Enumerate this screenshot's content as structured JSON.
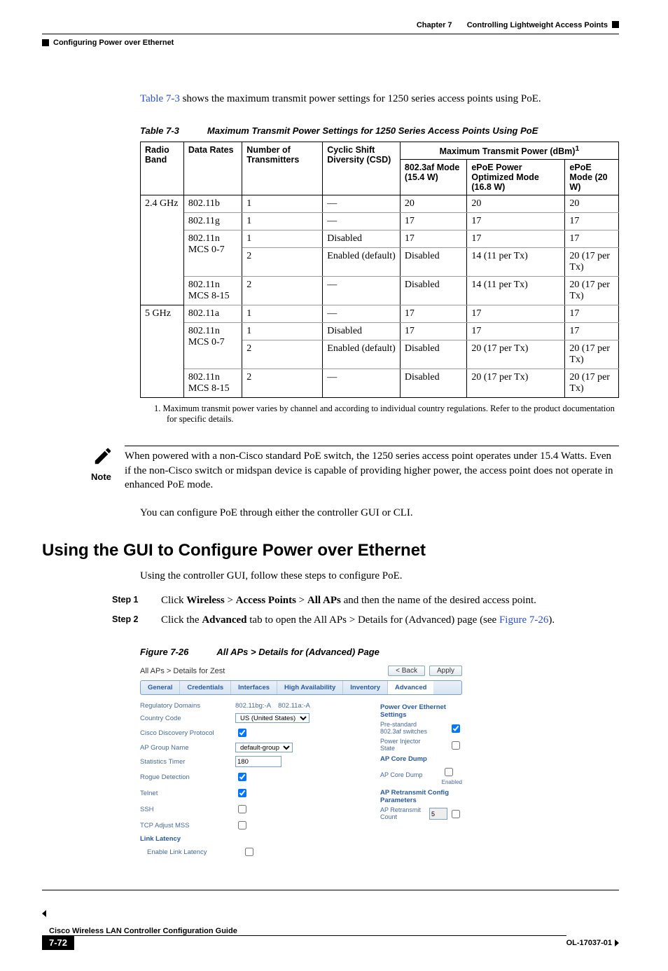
{
  "header": {
    "chapter_label": "Chapter 7",
    "chapter_title": "Controlling Lightweight Access Points",
    "section": "Configuring Power over Ethernet"
  },
  "intro_pre": "Table 7-3",
  "intro_post": " shows the maximum transmit power settings for 1250 series access points using PoE.",
  "table_caption_label": "Table 7-3",
  "table_caption_title": "Maximum Transmit Power Settings for 1250 Series Access Points Using PoE",
  "thead": {
    "c1": "Radio Band",
    "c2": "Data Rates",
    "c3": "Number of Transmitters",
    "c4": "Cyclic Shift Diversity (CSD)",
    "c5": "Maximum Transmit Power (dBm)",
    "c5_sup": "1",
    "c5a": "802.3af Mode (15.4 W)",
    "c5b": "ePoE Power Optimized Mode (16.8 W)",
    "c5c": "ePoE Mode (20 W)"
  },
  "rows": [
    {
      "band": "2.4 GHz",
      "rate": "802.11b",
      "tx": "1",
      "csd": "—",
      "a": "20",
      "b": "20",
      "c": "20"
    },
    {
      "band": "",
      "rate": "802.11g",
      "tx": "1",
      "csd": "—",
      "a": "17",
      "b": "17",
      "c": "17"
    },
    {
      "band": "",
      "rate": "802.11n MCS 0-7",
      "tx": "1",
      "csd": "Disabled",
      "a": "17",
      "b": "17",
      "c": "17"
    },
    {
      "band": "",
      "rate": "",
      "tx": "2",
      "csd": "Enabled (default)",
      "a": "Disabled",
      "b": "14 (11 per Tx)",
      "c": "20 (17 per Tx)"
    },
    {
      "band": "",
      "rate": "802.11n MCS 8-15",
      "tx": "2",
      "csd": "—",
      "a": "Disabled",
      "b": "14 (11 per Tx)",
      "c": "20 (17 per Tx)"
    },
    {
      "band": "5 GHz",
      "rate": "802.11a",
      "tx": "1",
      "csd": "—",
      "a": "17",
      "b": "17",
      "c": "17"
    },
    {
      "band": "",
      "rate": "802.11n MCS 0-7",
      "tx": "1",
      "csd": "Disabled",
      "a": "17",
      "b": "17",
      "c": "17"
    },
    {
      "band": "",
      "rate": "",
      "tx": "2",
      "csd": "Enabled (default)",
      "a": "Disabled",
      "b": "20 (17 per Tx)",
      "c": "20 (17 per Tx)"
    },
    {
      "band": "",
      "rate": "802.11n MCS 8-15",
      "tx": "2",
      "csd": "—",
      "a": "Disabled",
      "b": "20 (17 per Tx)",
      "c": "20 (17 per Tx)"
    }
  ],
  "footnote": "1.   Maximum transmit power varies by channel and according to individual country regulations. Refer to the product documentation for specific details.",
  "note_label": "Note",
  "note_text": "When powered with a non-Cisco standard PoE switch, the 1250 series access point operates under 15.4 Watts. Even if the non-Cisco switch or midspan device is capable of providing higher power, the access point does not operate in enhanced PoE mode.",
  "after_note": "You can configure PoE through either the controller GUI or CLI.",
  "h2": "Using the GUI to Configure Power over Ethernet",
  "h2_intro": "Using the controller GUI, follow these steps to configure PoE.",
  "steps": [
    {
      "label": "Step 1",
      "pre": "Click ",
      "b1": "Wireless",
      "mid1": " > ",
      "b2": "Access Points",
      "mid2": " > ",
      "b3": "All APs",
      "post": " and then the name of the desired access point."
    },
    {
      "label": "Step 2",
      "pre": "Click the ",
      "b1": "Advanced",
      "post1": " tab to open the All APs > Details for (Advanced) page (see ",
      "link": "Figure 7-26",
      "post2": ")."
    }
  ],
  "figure_caption_label": "Figure 7-26",
  "figure_caption_title": "All APs > Details for (Advanced) Page",
  "gui": {
    "crumb": "All APs > Details for Zest",
    "btn_back": "< Back",
    "btn_apply": "Apply",
    "tabs": [
      "General",
      "Credentials",
      "Interfaces",
      "High Availability",
      "Inventory",
      "Advanced"
    ],
    "left": {
      "regdom_l": "Regulatory Domains",
      "regdom_v": "802.11bg:-A    802.11a:-A",
      "cc_l": "Country Code",
      "cc_v": "US (United States)",
      "cdp_l": "Cisco Discovery Protocol",
      "grp_l": "AP Group Name",
      "grp_v": "default-group",
      "st_l": "Statistics Timer",
      "st_v": "180",
      "rd_l": "Rogue Detection",
      "tel_l": "Telnet",
      "ssh_l": "SSH",
      "mss_l": "TCP Adjust MSS",
      "ll_h": "Link Latency",
      "ll_l": "Enable Link Latency"
    },
    "right": {
      "poe_h": "Power Over Ethernet Settings",
      "pre_l": "Pre-standard 802.3af switches",
      "inj_l": "Power Injector State",
      "core_h": "AP Core Dump",
      "core_l": "AP Core Dump",
      "enabled": "Enabled",
      "ret_h": "AP Retransmit Config Parameters",
      "ret_l": "AP Retransmit Count",
      "ret_v": "5"
    }
  },
  "footer": {
    "book": "Cisco Wireless LAN Controller Configuration Guide",
    "page": "7-72",
    "docid": "OL-17037-01"
  }
}
